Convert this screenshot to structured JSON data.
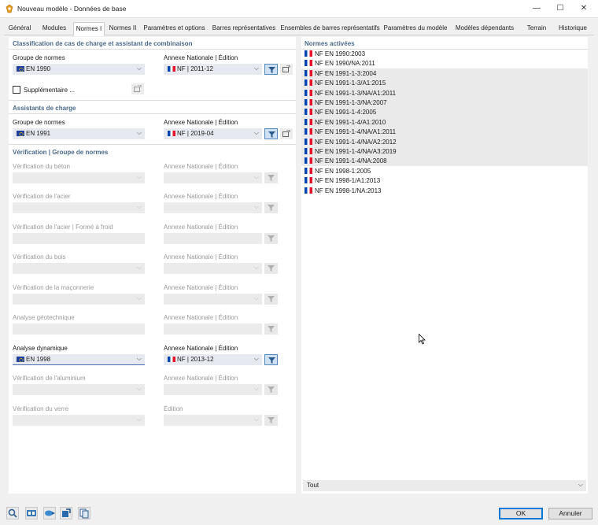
{
  "window": {
    "title": "Nouveau modèle - Données de base",
    "controls": {
      "minimize": "—",
      "maximize": "☐",
      "close": "✕"
    }
  },
  "tabs": [
    {
      "label": "Général"
    },
    {
      "label": "Modules"
    },
    {
      "label": "Normes I",
      "active": true
    },
    {
      "label": "Normes II"
    },
    {
      "label": "Paramètres et options"
    },
    {
      "label": "Barres représentatives"
    },
    {
      "label": "Ensembles de barres représentatifs"
    },
    {
      "label": "Paramètres du modèle"
    },
    {
      "label": "Modèles dépendants"
    },
    {
      "label": "Terrain"
    },
    {
      "label": "Historique"
    }
  ],
  "classification": {
    "title": "Classification de cas de charge et assistant de combinaison",
    "group_label": "Groupe de normes",
    "group_value": "EN 1990",
    "annex_label": "Annexe Nationale | Édition",
    "annex_value": "NF | 2011-12",
    "supplementary_label": "Supplémentaire ..."
  },
  "load_assistants": {
    "title": "Assistants de charge",
    "group_label": "Groupe de normes",
    "group_value": "EN 1991",
    "annex_label": "Annexe Nationale | Édition",
    "annex_value": "NF | 2019-04"
  },
  "verification": {
    "title": "Vérification | Groupe de normes",
    "rows": [
      {
        "label": "Vérification du béton",
        "annex_label": "Annexe Nationale | Édition",
        "value": "",
        "annex_value": "",
        "enabled": false,
        "has_dropdown": true
      },
      {
        "label": "Vérification de l'acier",
        "annex_label": "Annexe Nationale | Édition",
        "value": "",
        "annex_value": "",
        "enabled": false,
        "has_dropdown": true
      },
      {
        "label": "Vérification de l'acier | Formé à froid",
        "annex_label": "Annexe Nationale | Édition",
        "value": "",
        "annex_value": "",
        "enabled": false,
        "has_dropdown": false
      },
      {
        "label": "Vérification du bois",
        "annex_label": "Annexe Nationale | Édition",
        "value": "",
        "annex_value": "",
        "enabled": false,
        "has_dropdown": true
      },
      {
        "label": "Vérification de la maçonnerie",
        "annex_label": "Annexe Nationale | Édition",
        "value": "",
        "annex_value": "",
        "enabled": false,
        "has_dropdown": true
      },
      {
        "label": "Analyse géotechnique",
        "annex_label": "Annexe Nationale | Édition",
        "value": "",
        "annex_value": "",
        "enabled": false,
        "has_dropdown": false
      },
      {
        "label": "Analyse dynamique",
        "annex_label": "Annexe Nationale | Édition",
        "value": "EN 1998",
        "annex_value": "NF | 2013-12",
        "enabled": true,
        "has_dropdown": true
      },
      {
        "label": "Vérification de l'aluminium",
        "annex_label": "Annexe Nationale | Édition",
        "value": "",
        "annex_value": "",
        "enabled": false,
        "has_dropdown": true
      },
      {
        "label": "Vérification du verre",
        "annex_label": "Édition",
        "value": "",
        "annex_value": "",
        "enabled": false,
        "has_dropdown": true
      }
    ]
  },
  "active_norms": {
    "title": "Normes activées",
    "items": [
      {
        "label": "NF EN 1990:2003",
        "shaded": false
      },
      {
        "label": "NF EN 1990/NA:2011",
        "shaded": false
      },
      {
        "label": "NF EN 1991-1-3:2004",
        "shaded": true
      },
      {
        "label": "NF EN 1991-1-3/A1:2015",
        "shaded": true
      },
      {
        "label": "NF EN 1991-1-3/NA/A1:2011",
        "shaded": true
      },
      {
        "label": "NF EN 1991-1-3/NA:2007",
        "shaded": true
      },
      {
        "label": "NF EN 1991-1-4:2005",
        "shaded": true
      },
      {
        "label": "NF EN 1991-1-4/A1:2010",
        "shaded": true
      },
      {
        "label": "NF EN 1991-1-4/NA/A1:2011",
        "shaded": true
      },
      {
        "label": "NF EN 1991-1-4/NA/A2:2012",
        "shaded": true
      },
      {
        "label": "NF EN 1991-1-4/NA/A3:2019",
        "shaded": true
      },
      {
        "label": "NF EN 1991-1-4/NA:2008",
        "shaded": true
      },
      {
        "label": "NF EN 1998-1:2005",
        "shaded": false
      },
      {
        "label": "NF EN 1998-1/A1:2013",
        "shaded": false
      },
      {
        "label": "NF EN 1998-1/NA:2013",
        "shaded": false
      }
    ],
    "filter_value": "Tout"
  },
  "footer": {
    "icons": [
      "search-icon",
      "units-icon",
      "display-icon",
      "export-icon",
      "copy-icon"
    ],
    "ok_label": "OK",
    "cancel_label": "Annuler"
  },
  "colors": {
    "section_title": "#4a6a8a",
    "filter_active": "#cde0f4",
    "eu_flag": "#1f3f9e"
  }
}
